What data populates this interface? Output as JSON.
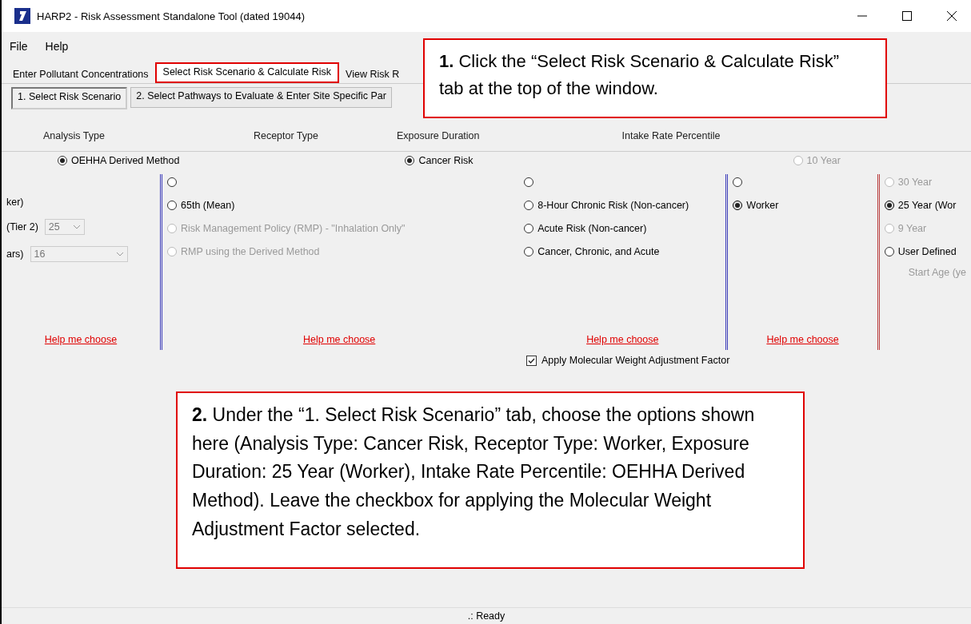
{
  "window": {
    "title": "HARP2 - Risk Assessment Standalone Tool (dated 19044)"
  },
  "menu": [
    "File",
    "Help"
  ],
  "tabs": [
    {
      "label": "Enter Pollutant Concentrations",
      "selected": false
    },
    {
      "label": "Select Risk Scenario & Calculate Risk",
      "selected": true
    },
    {
      "label": "View Risk R",
      "selected": false
    }
  ],
  "subtabs": [
    {
      "label": "1.  Select Risk Scenario",
      "selected": true
    },
    {
      "label": "2.  Select Pathways to Evaluate & Enter Site Specific Par",
      "selected": false
    }
  ],
  "groups": [
    "Analysis Type",
    "Receptor Type",
    "Exposure Duration",
    "Intake Rate Percentile"
  ],
  "overlay_options": [
    {
      "label": "OEHHA Derived Method",
      "selected": true,
      "disabled": false
    },
    {
      "label": "Cancer Risk",
      "selected": true,
      "disabled": false
    },
    {
      "label": "10 Year",
      "selected": false,
      "disabled": true
    }
  ],
  "columns": [
    {
      "items": [
        {
          "kind": "text",
          "label": "ker)"
        },
        {
          "kind": "dropdown",
          "label": "(Tier 2)",
          "value": "25"
        },
        {
          "kind": "dropdown",
          "label": "ars)",
          "value": "16"
        }
      ],
      "help_link": "Help me choose"
    },
    {
      "items": [
        {
          "kind": "radio",
          "selected": false,
          "disabled": false
        },
        {
          "kind": "radio",
          "label": "65th (Mean)",
          "selected": false,
          "disabled": false
        },
        {
          "kind": "radio",
          "label": "Risk Management Policy (RMP) - \"Inhalation Only\"",
          "selected": false,
          "disabled": true
        },
        {
          "kind": "radio",
          "label": "RMP using the Derived Method",
          "selected": false,
          "disabled": true
        }
      ],
      "help_link": "Help me choose"
    },
    {
      "items": [
        {
          "kind": "radio",
          "selected": false,
          "disabled": false
        },
        {
          "kind": "radio",
          "label": "8-Hour Chronic Risk (Non-cancer)",
          "selected": false,
          "disabled": false
        },
        {
          "kind": "radio",
          "label": "Acute Risk (Non-cancer)",
          "selected": false,
          "disabled": false
        },
        {
          "kind": "radio",
          "label": "Cancer, Chronic, and Acute",
          "selected": false,
          "disabled": false
        }
      ],
      "help_link": "Help me choose"
    },
    {
      "items": [
        {
          "kind": "radio",
          "selected": false,
          "disabled": false
        },
        {
          "kind": "radio",
          "label": "Worker",
          "selected": true,
          "disabled": false
        }
      ],
      "help_link": "Help me choose"
    },
    {
      "items": [
        {
          "kind": "radio",
          "label": "30 Year",
          "selected": false,
          "disabled": true
        },
        {
          "kind": "radio",
          "label": "25 Year (Wor",
          "selected": true,
          "disabled": false
        },
        {
          "kind": "radio",
          "label": "9 Year",
          "selected": false,
          "disabled": true
        },
        {
          "kind": "radio",
          "label": "User Defined",
          "selected": false,
          "disabled": false
        },
        {
          "kind": "hint",
          "label": "Start Age (ye"
        }
      ]
    }
  ],
  "checkbox": {
    "label": "Apply Molecular Weight Adjustment Factor",
    "checked": true
  },
  "callouts": [
    "**1.**  Click the “Select Risk Scenario & Calculate Risk” tab at the top of the window.",
    "**2.**  Under the “1. Select Risk Scenario” tab, choose the options shown here (Analysis Type: Cancer Risk, Receptor Type: Worker, Exposure Duration: 25 Year (Worker), Intake Rate Percentile: OEHHA Derived Method).  Leave the checkbox for applying the Molecular Weight Adjustment Factor selected."
  ],
  "status_bar": ".: Ready"
}
